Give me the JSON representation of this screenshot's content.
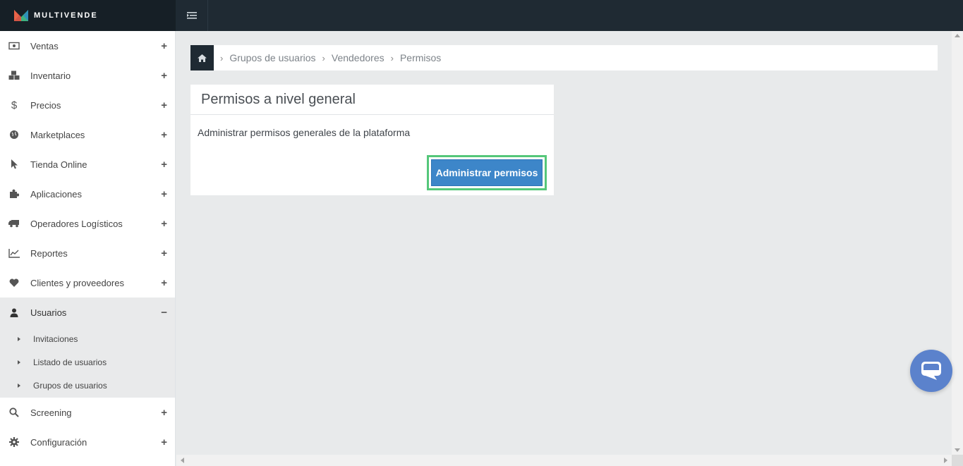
{
  "brand": {
    "name": "MULTIVENDE"
  },
  "sidebar": {
    "items": [
      {
        "label": "Ventas",
        "icon": "money-icon",
        "toggle": "+"
      },
      {
        "label": "Inventario",
        "icon": "cubes-icon",
        "toggle": "+"
      },
      {
        "label": "Precios",
        "icon": "dollar-icon",
        "toggle": "+"
      },
      {
        "label": "Marketplaces",
        "icon": "globe-icon",
        "toggle": "+"
      },
      {
        "label": "Tienda Online",
        "icon": "cursor-icon",
        "toggle": "+"
      },
      {
        "label": "Aplicaciones",
        "icon": "puzzle-icon",
        "toggle": "+"
      },
      {
        "label": "Operadores Logísticos",
        "icon": "truck-icon",
        "toggle": "+"
      },
      {
        "label": "Reportes",
        "icon": "line-chart-icon",
        "toggle": "+"
      },
      {
        "label": "Clientes y proveedores",
        "icon": "heart-icon",
        "toggle": "+"
      },
      {
        "label": "Usuarios",
        "icon": "user-icon",
        "toggle": "−"
      },
      {
        "label": "Screening",
        "icon": "search-icon",
        "toggle": "+"
      },
      {
        "label": "Configuración",
        "icon": "gear-icon",
        "toggle": "+"
      }
    ],
    "usuarios_sub": [
      {
        "label": "Invitaciones"
      },
      {
        "label": "Listado de usuarios"
      },
      {
        "label": "Grupos de usuarios"
      }
    ]
  },
  "breadcrumb": {
    "home_icon": "home-icon",
    "items": [
      "Grupos de usuarios",
      "Vendedores",
      "Permisos"
    ],
    "separator": ">"
  },
  "panel": {
    "title": "Permisos a nivel general",
    "description": "Administrar permisos generales de la plataforma",
    "button_label": "Administrar permisos"
  },
  "colors": {
    "topbar": "#1f2a33",
    "primary_button": "#3d86c9",
    "highlight_border": "#55c77a",
    "chat_button": "#5b82cc"
  }
}
